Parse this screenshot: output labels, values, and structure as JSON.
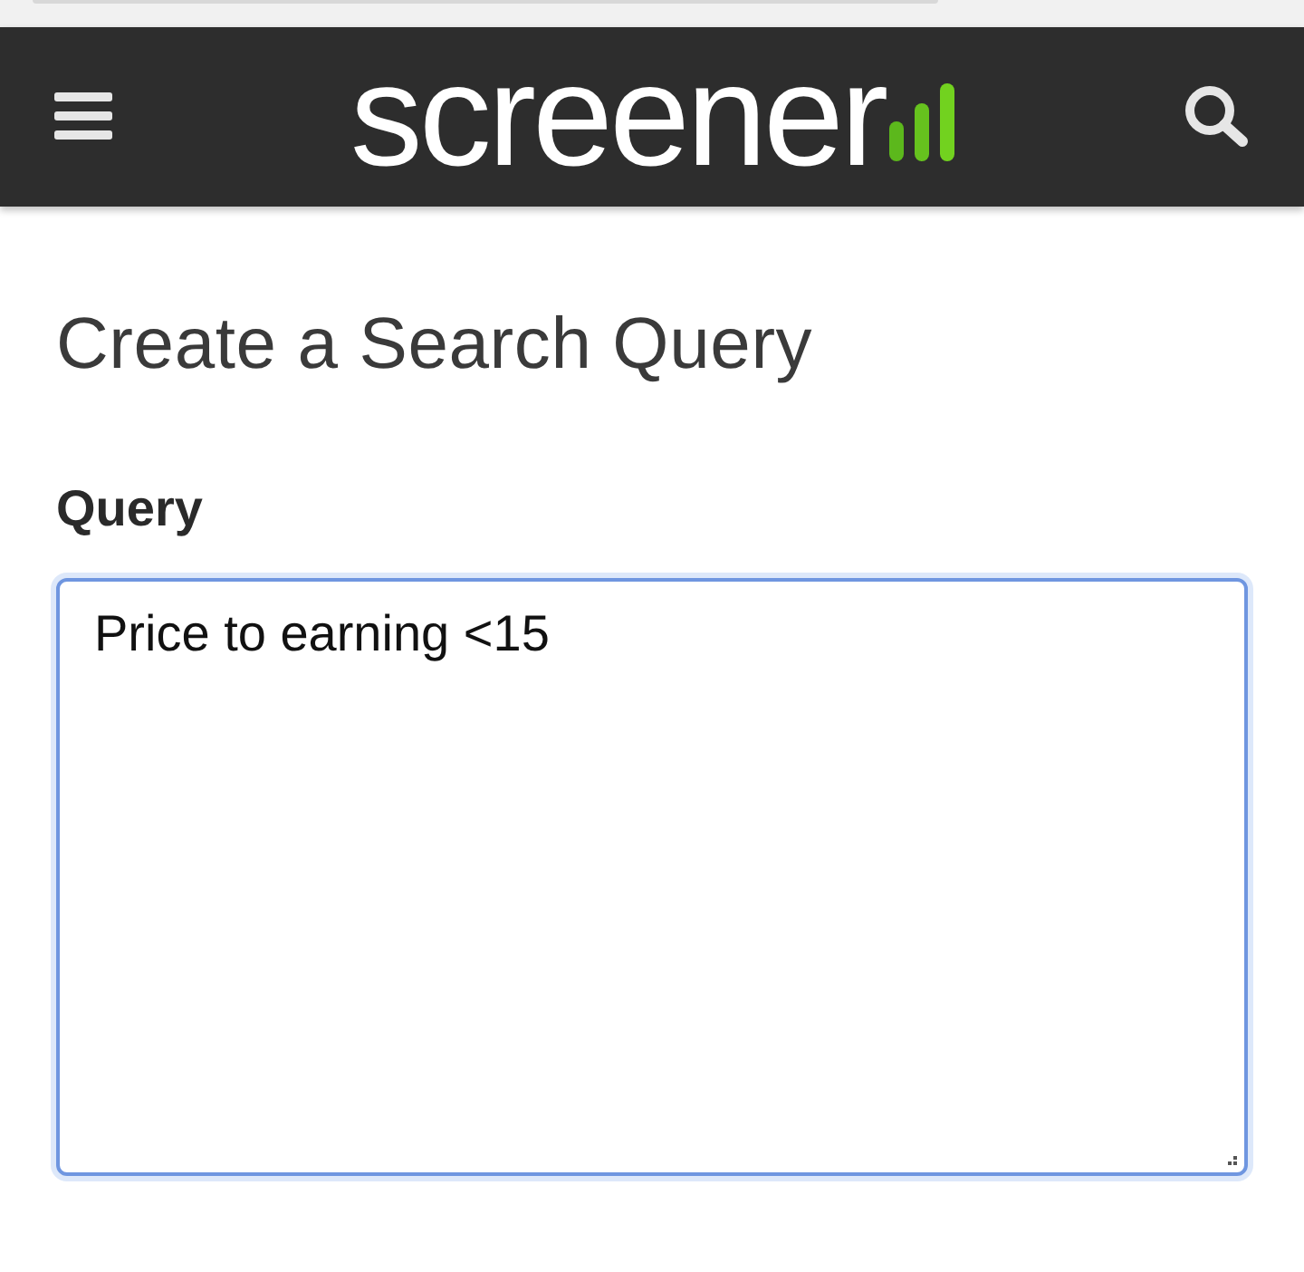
{
  "header": {
    "logo": "screener"
  },
  "page": {
    "title": "Create a Search Query"
  },
  "query_field": {
    "label": "Query",
    "value": "Price to earning <15",
    "focused": true
  }
}
